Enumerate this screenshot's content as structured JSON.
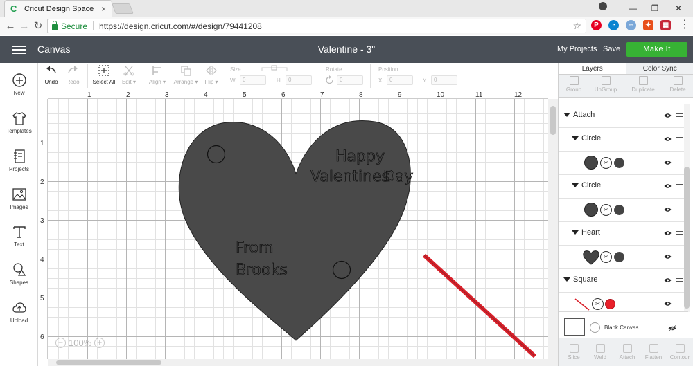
{
  "browser": {
    "tab_title": "Cricut Design Space",
    "tab_close": "×",
    "secure_label": "Secure",
    "url": "https://design.cricut.com/#/design/79441208",
    "win_min": "—",
    "win_max": "❐",
    "win_close": "✕"
  },
  "header": {
    "app_title": "Canvas",
    "project_title": "Valentine - 3\"",
    "my_projects": "My Projects",
    "save": "Save",
    "make_it": "Make It"
  },
  "sidebar": {
    "items": [
      {
        "label": "New",
        "icon": "plus-circle-icon"
      },
      {
        "label": "Templates",
        "icon": "shirt-icon"
      },
      {
        "label": "Projects",
        "icon": "notebook-icon"
      },
      {
        "label": "Images",
        "icon": "image-icon"
      },
      {
        "label": "Text",
        "icon": "text-icon"
      },
      {
        "label": "Shapes",
        "icon": "shapes-icon"
      },
      {
        "label": "Upload",
        "icon": "cloud-upload-icon"
      }
    ]
  },
  "toolbar": {
    "undo": "Undo",
    "redo": "Redo",
    "select_all": "Select All",
    "edit": "Edit",
    "align": "Align",
    "arrange": "Arrange",
    "flip": "Flip",
    "size": "Size",
    "w": "W",
    "h": "H",
    "rotate": "Rotate",
    "position": "Position",
    "x": "X",
    "y": "Y",
    "field_zero": "0"
  },
  "rulers": {
    "top": [
      "1",
      "2",
      "3",
      "4",
      "5",
      "6",
      "7",
      "8",
      "9",
      "10",
      "11",
      "12"
    ],
    "left": [
      "1",
      "2",
      "3",
      "4",
      "5",
      "6"
    ]
  },
  "canvas": {
    "text_happy": "Happy",
    "text_valentines": "Valentines",
    "text_day": "Day",
    "text_from": "From",
    "text_brooks": "Brooks",
    "zoom_minus": "−",
    "zoom": "100%",
    "zoom_plus": "+",
    "heart_color": "#494949",
    "line_color": "#d9202a"
  },
  "layers_panel": {
    "tab_layers": "Layers",
    "tab_color_sync": "Color Sync",
    "tools": [
      "Group",
      "UnGroup",
      "Duplicate",
      "Delete"
    ],
    "rows": [
      {
        "name": "Attach",
        "type": "group"
      },
      {
        "name": "Circle",
        "type": "subgroup"
      },
      {
        "name": "",
        "type": "item-circle"
      },
      {
        "name": "Circle",
        "type": "subgroup"
      },
      {
        "name": "",
        "type": "item-circle"
      },
      {
        "name": "Heart",
        "type": "subgroup"
      },
      {
        "name": "",
        "type": "item-heart"
      },
      {
        "name": "Square",
        "type": "group"
      },
      {
        "name": "",
        "type": "item-line"
      }
    ],
    "blank_canvas": "Blank Canvas",
    "bottom_tools": [
      "Slice",
      "Weld",
      "Attach",
      "Flatten",
      "Contour"
    ]
  }
}
